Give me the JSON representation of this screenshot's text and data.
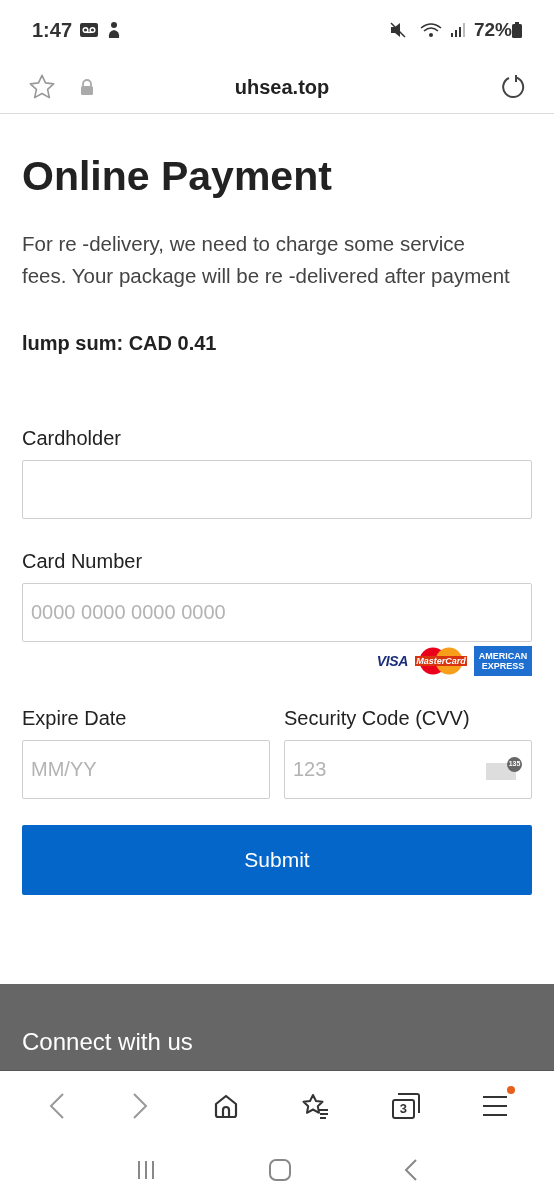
{
  "status_bar": {
    "time": "1:47",
    "battery": "72%"
  },
  "browser": {
    "url": "uhsea.top",
    "tab_count": "3",
    "menu_badge": true
  },
  "page": {
    "title": "Online Payment",
    "description": "For re -delivery, we need to charge some service fees. Your package will be re -delivered after payment",
    "amount": "lump sum: CAD 0.41"
  },
  "form": {
    "cardholder": {
      "label": "Cardholder"
    },
    "card_number": {
      "label": "Card Number",
      "placeholder": "0000 0000 0000 0000"
    },
    "card_logos": [
      {
        "kind": "visa",
        "text": "VISA"
      },
      {
        "kind": "mastercard",
        "text": "MasterCard"
      },
      {
        "kind": "amex",
        "text": "AMERICAN EXPRESS"
      }
    ],
    "expire": {
      "label": "Expire Date",
      "placeholder": "MM/YY"
    },
    "cvv": {
      "label": "Security Code (CVV)",
      "placeholder": "123",
      "hint": "135"
    },
    "submit": "Submit"
  },
  "footer": {
    "heading": "Connect with us"
  }
}
